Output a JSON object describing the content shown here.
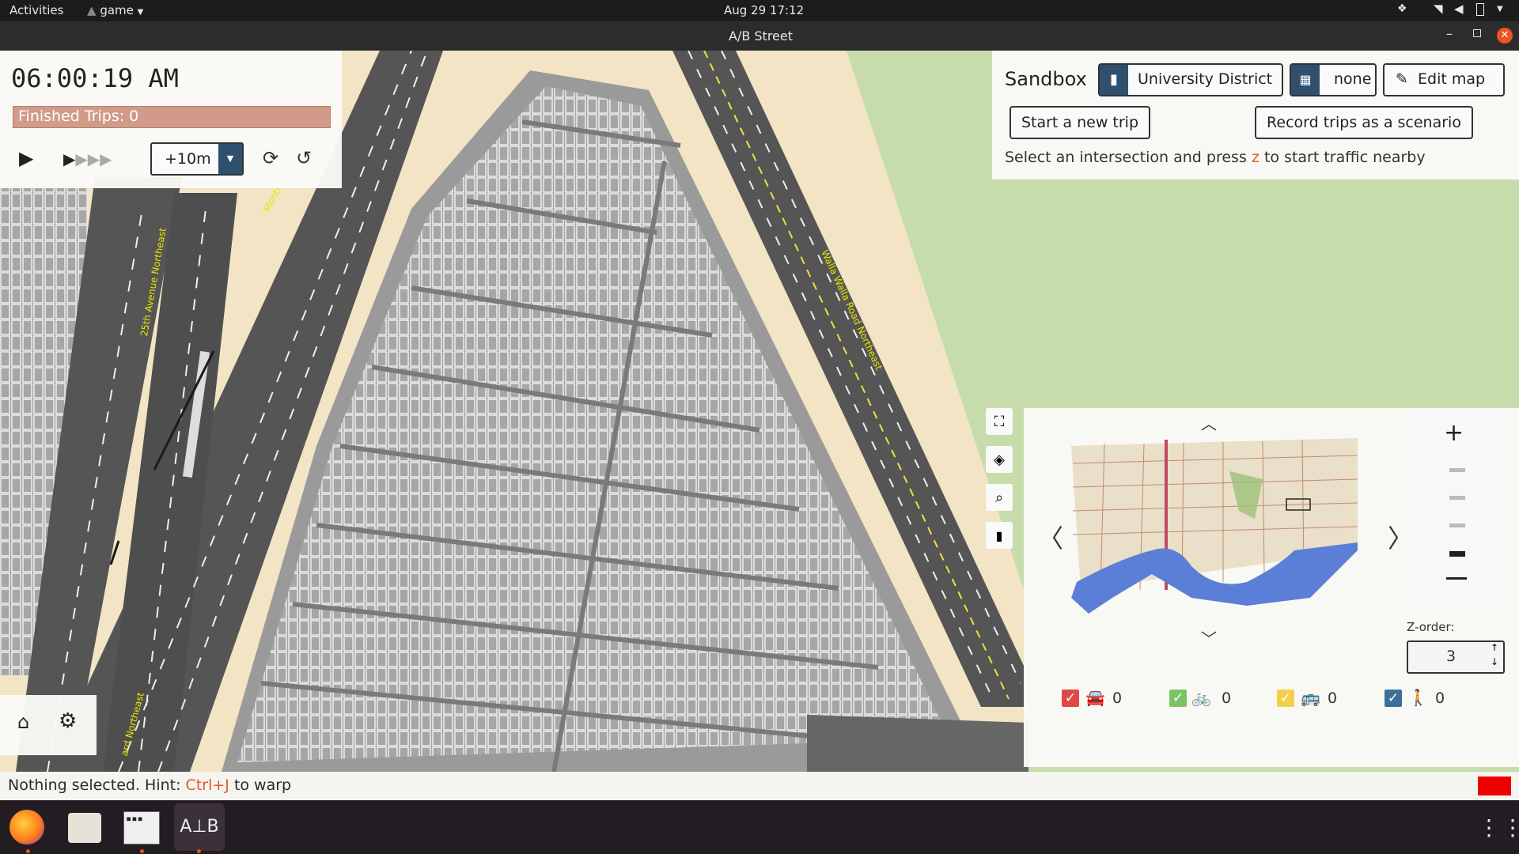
{
  "topbar": {
    "activities": "Activities",
    "app_menu": "game",
    "datetime": "Aug 29  17:12"
  },
  "window": {
    "title": "A/B Street"
  },
  "time_panel": {
    "clock": "06:00:19 AM",
    "finished_trips": "Finished Trips: 0",
    "step_value": "+10m"
  },
  "sandbox": {
    "title": "Sandbox",
    "map_name": "University District",
    "scenario": "none",
    "edit_map": "Edit map",
    "start_trip": "Start a new trip",
    "record_trips": "Record trips as a scenario",
    "hint_before": "Select an intersection and press",
    "hint_key": "z",
    "hint_after": "to start traffic nearby"
  },
  "minimap": {
    "zorder_label": "Z-order:",
    "zorder_value": "3",
    "counts": {
      "car": "0",
      "bike": "0",
      "bus": "0",
      "pedestrian": "0"
    },
    "filter_colors": {
      "car": "#e04848",
      "bike": "#7bc463",
      "bus": "#f4cf4a",
      "pedestrian": "#3d6e9a"
    }
  },
  "map_labels": {
    "street_1": "Montlake Boulevard Northeast",
    "street_2": "25th Avenue Northeast",
    "street_3": "Walla Walla Road Northeast",
    "street_4": "ard Northeast"
  },
  "status": {
    "hint_before": "Nothing selected. Hint:",
    "hint_key": "Ctrl+J",
    "hint_after": "to warp"
  },
  "colors": {
    "accent_key": "#e8572a",
    "finished_bar": "#d29a88",
    "dark_button": "#2f4f6f",
    "grass": "#c6dcab",
    "sand": "#f2e4c4",
    "road": "#555555",
    "parking": "#a6a6a6"
  }
}
